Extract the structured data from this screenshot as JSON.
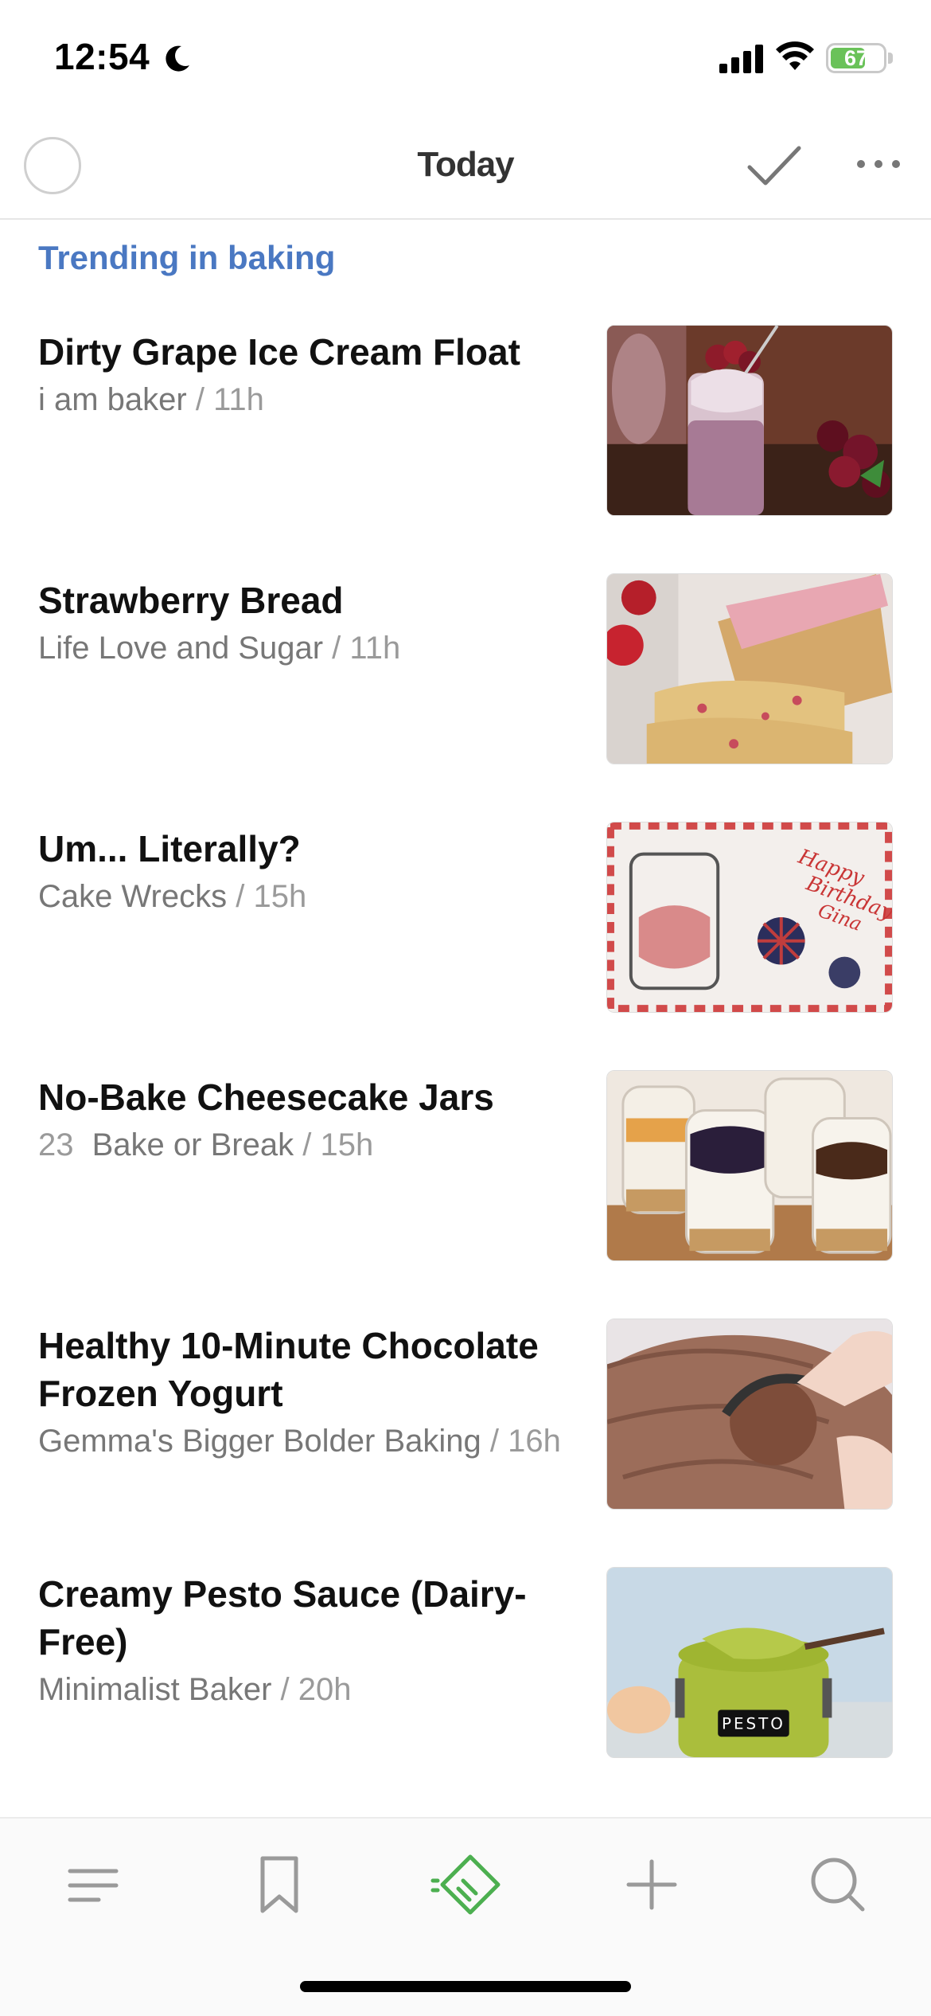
{
  "status_bar": {
    "time": "12:54",
    "battery": "67",
    "battery_level": 0.67,
    "icons": [
      "moon-icon",
      "cellular-signal-icon",
      "wifi-icon",
      "battery-icon"
    ]
  },
  "nav": {
    "title": "Today",
    "icons": [
      "loading-spinner-icon",
      "mark-read-check-icon",
      "more-options-icon"
    ]
  },
  "section": {
    "title": "Trending in baking"
  },
  "articles": [
    {
      "title": "Dirty Grape Ice Cream Float",
      "source": "i am baker",
      "separator": "/",
      "age": "11h",
      "count": ""
    },
    {
      "title": "Strawberry Bread",
      "source": "Life Love and Sugar",
      "separator": "/",
      "age": "11h",
      "count": ""
    },
    {
      "title": "Um... Literally?",
      "source": "Cake Wrecks",
      "separator": "/",
      "age": "15h",
      "count": ""
    },
    {
      "title": "No-Bake Cheesecake Jars",
      "source": "Bake or Break",
      "separator": "/",
      "age": "15h",
      "count": "23"
    },
    {
      "title": "Healthy 10-Minute Chocolate Frozen Yogurt",
      "source": "Gemma's Bigger Bolder Baking",
      "separator": "/",
      "age": "16h",
      "count": ""
    },
    {
      "title": "Creamy Pesto Sauce (Dairy-Free)",
      "source": "Minimalist Baker",
      "separator": "/",
      "age": "20h",
      "count": ""
    }
  ],
  "thumb_text": {
    "cake_line1": "Happy",
    "cake_line2": "Birthday",
    "cake_line3": "Gina",
    "pesto_label": "PESTO"
  },
  "tab_bar": {
    "tabs": [
      "menu-icon",
      "bookmark-icon",
      "today-feed-icon",
      "add-icon",
      "search-icon"
    ],
    "active": "today-feed-icon",
    "active_color": "#4caf50",
    "inactive_color": "#9a9a9a"
  },
  "colors": {
    "section_accent": "#4a78c2",
    "battery_fill": "#6ac259"
  }
}
